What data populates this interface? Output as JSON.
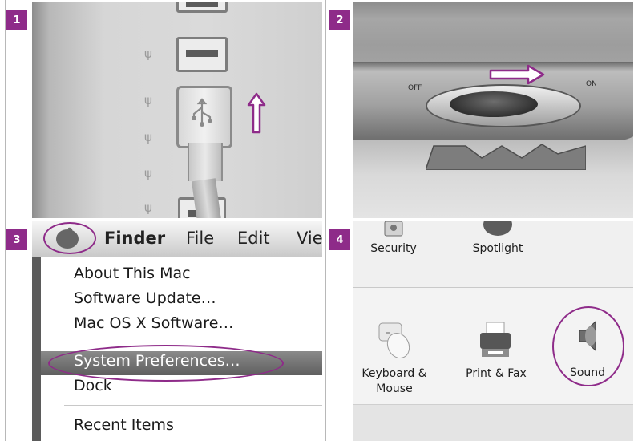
{
  "colors": {
    "accent": "#8e2b89",
    "divider": "#b8b8b8"
  },
  "steps": [
    "1",
    "2",
    "3",
    "4"
  ],
  "switch": {
    "off_label": "OFF",
    "on_label": "ON"
  },
  "menu": {
    "bar": [
      "Finder",
      "File",
      "Edit",
      "Vie"
    ],
    "items": [
      "About This Mac",
      "Software Update…",
      "Mac OS X Software…",
      "System Preferences…",
      "Dock",
      "Recent Items"
    ],
    "highlighted": "System Preferences…"
  },
  "prefs": {
    "row1": [
      "Security",
      "Spotlight"
    ],
    "row2": [
      "Keyboard &",
      "Mouse",
      "Print & Fax",
      "Sound"
    ]
  },
  "icons": [
    "usb-icon",
    "up-arrow-icon",
    "right-arrow-icon",
    "apple-icon",
    "security-icon",
    "spotlight-icon",
    "keyboard-mouse-icon",
    "printer-icon",
    "speaker-icon"
  ]
}
